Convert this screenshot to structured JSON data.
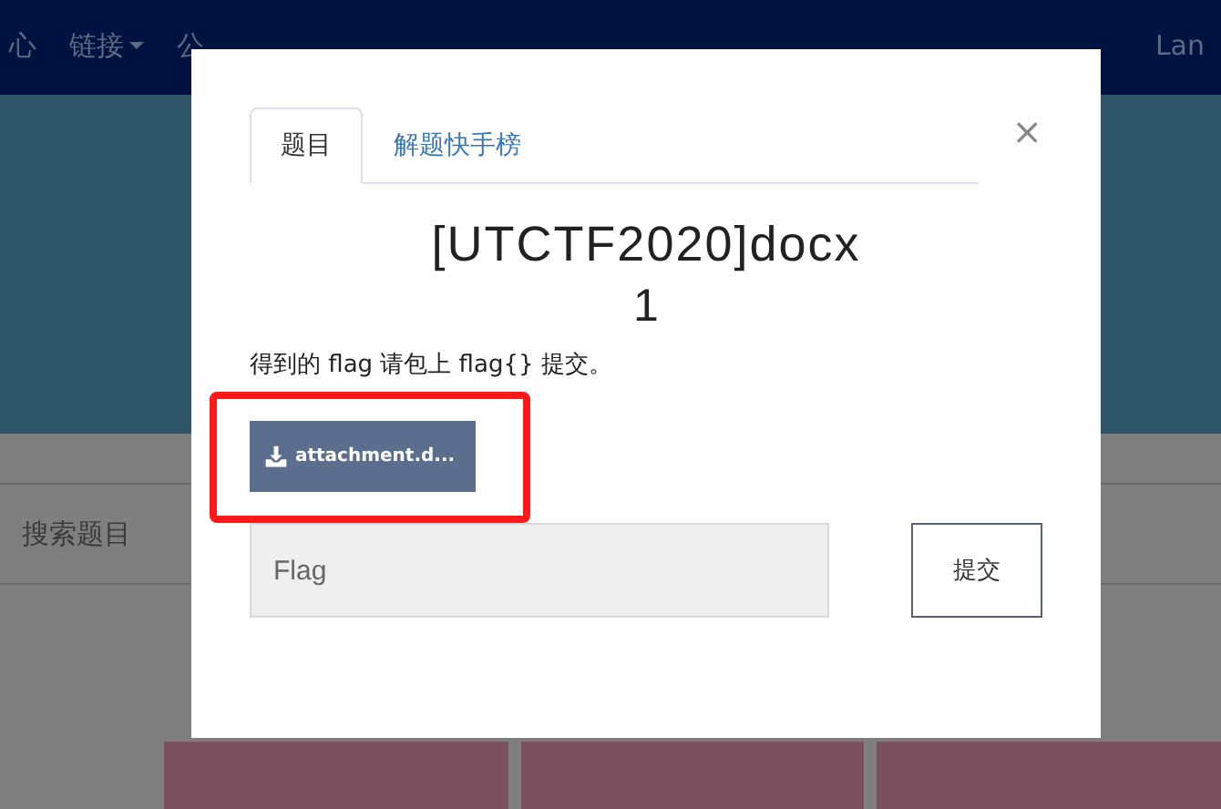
{
  "navbar": {
    "items": [
      {
        "label": "心",
        "dropdown": false
      },
      {
        "label": "链接",
        "dropdown": true
      },
      {
        "label": "公",
        "dropdown": false
      }
    ],
    "right_item": "Lan"
  },
  "search_label": "搜索题目",
  "challenge_cards": [
    {
      "kind": "card"
    },
    {
      "kind": "card"
    },
    {
      "kind": "card"
    }
  ],
  "modal": {
    "tabs": [
      {
        "label": "题目",
        "selected": true
      },
      {
        "label": "解题快手榜",
        "selected": false
      }
    ],
    "close": "×",
    "title": "[UTCTF2020]docx",
    "score": "1",
    "description": "得到的 flag 请包上 flag{} 提交。",
    "attachment": {
      "label": "attachment.d...",
      "highlighted": true
    },
    "flag_field": {
      "placeholder": "Flag"
    },
    "submit": "提交"
  }
}
